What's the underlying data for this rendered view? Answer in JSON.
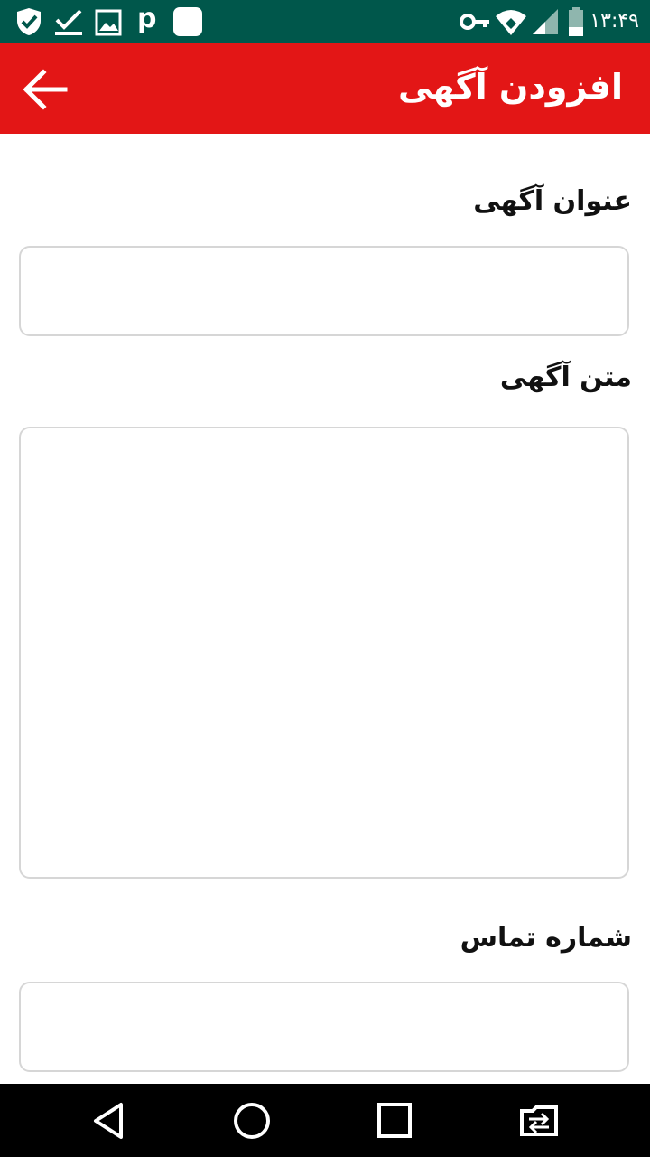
{
  "status_bar": {
    "time": "۱۳:۴۹",
    "icons": [
      "shield-check-icon",
      "download-done-icon",
      "image-icon",
      "p-letter-icon",
      "app-square-icon",
      "vpn-key-icon",
      "wifi-icon",
      "signal-icon",
      "battery-icon"
    ]
  },
  "app_bar": {
    "title": "افزودن آگهی",
    "back_icon": "arrow-left-icon",
    "background": "#e31616"
  },
  "form": {
    "title_label": "عنوان آگهی",
    "title_value": "",
    "body_label": "متن آگهی",
    "body_value": "",
    "phone_label": "شماره تماس",
    "phone_value": ""
  },
  "nav_bar": {
    "buttons": [
      "back-triangle-icon",
      "home-circle-icon",
      "recents-square-icon",
      "switch-app-icon"
    ]
  },
  "colors": {
    "status_bar": "#00574b",
    "accent": "#e31616",
    "field_border": "#d6d6d6"
  }
}
